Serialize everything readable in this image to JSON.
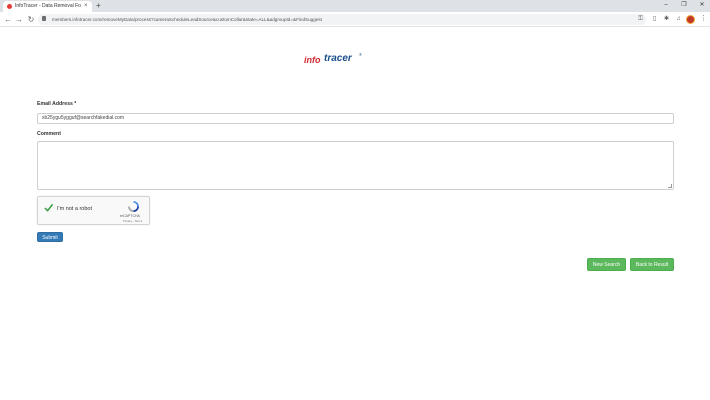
{
  "browser": {
    "tab_title": "InfoTracer - Data Removal Form",
    "tab_close": "×",
    "new_tab": "+",
    "window_controls": [
      "–",
      "❐",
      "✕"
    ],
    "nav": {
      "back": "←",
      "forward": "→",
      "reload": "↻"
    },
    "url": "members.infotracer.com/removeMyData/process?cameraScheduleLeadSource&customCollar&state=ALL&adgroupId=&FindSuggest"
  },
  "logo": {
    "info": "info",
    "tracer": "tracer",
    "tm": "®"
  },
  "form": {
    "email_label": "Email Address *",
    "email_value": "xb25ygu5ygguf@searchfakedial.com",
    "comment_label": "Comment",
    "comment_value": "",
    "captcha": {
      "text": "I'm not a robot",
      "brand": "reCAPTCHA",
      "terms": "Privacy - Terms"
    },
    "submit_label": "Submit"
  },
  "actions": {
    "new_search_label": "New Search",
    "back_label": "Back to Result"
  },
  "colors": {
    "primary": "#337ab7",
    "success": "#5cb85c",
    "logo_red": "#d0282e",
    "logo_blue": "#1a4f8c"
  }
}
